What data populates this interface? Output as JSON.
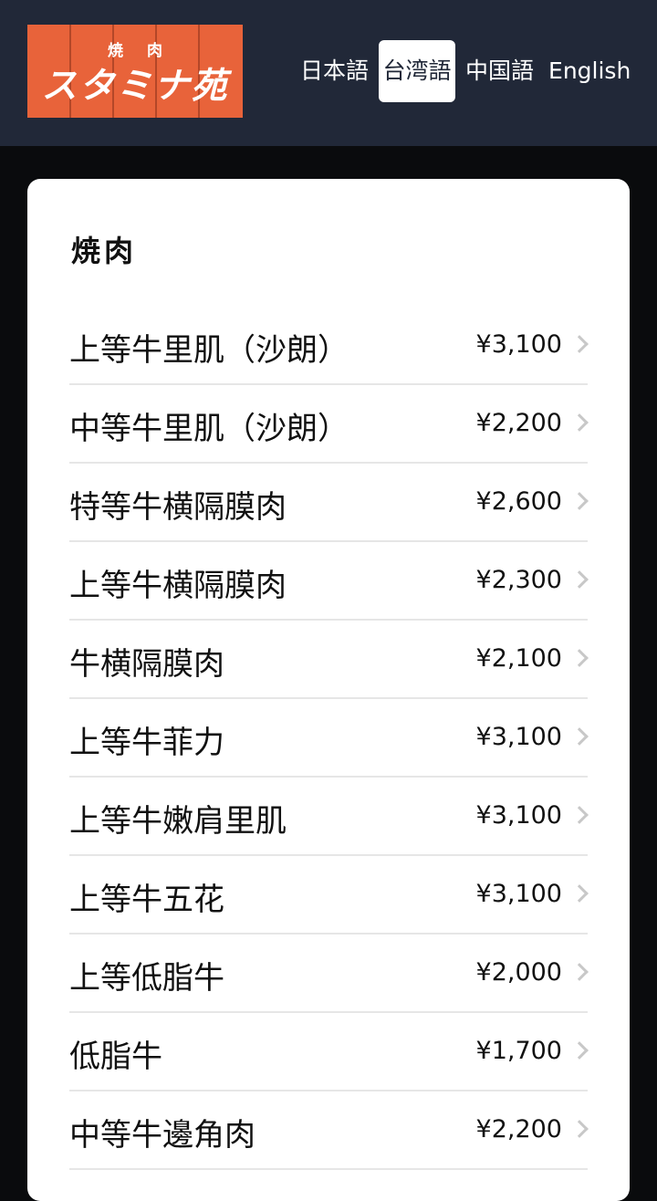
{
  "logo": {
    "small_text": "焼肉",
    "brand_text": "スタミナ苑"
  },
  "languages": [
    {
      "label": "日本語"
    },
    {
      "label": "台湾語"
    },
    {
      "label": "中国語"
    },
    {
      "label": "English"
    }
  ],
  "active_language": "台湾語",
  "section": {
    "title": "焼肉"
  },
  "menu_items": [
    {
      "name": "上等牛里肌（沙朗）",
      "price": "¥3,100"
    },
    {
      "name": "中等牛里肌（沙朗）",
      "price": "¥2,200"
    },
    {
      "name": "特等牛横隔膜肉",
      "price": "¥2,600"
    },
    {
      "name": "上等牛横隔膜肉",
      "price": "¥2,300"
    },
    {
      "name": "牛横隔膜肉",
      "price": "¥2,100"
    },
    {
      "name": "上等牛菲力",
      "price": "¥3,100"
    },
    {
      "name": "上等牛嫩肩里肌",
      "price": "¥3,100"
    },
    {
      "name": "上等牛五花",
      "price": "¥3,100"
    },
    {
      "name": "上等低脂牛",
      "price": "¥2,000"
    },
    {
      "name": "低脂牛",
      "price": "¥1,700"
    },
    {
      "name": "中等牛邊角肉",
      "price": "¥2,200"
    },
    {
      "name": "",
      "price": ""
    }
  ],
  "colors": {
    "header_bg": "#212838",
    "logo_bg": "#e8633a",
    "page_bg": "#0a0b0d"
  }
}
